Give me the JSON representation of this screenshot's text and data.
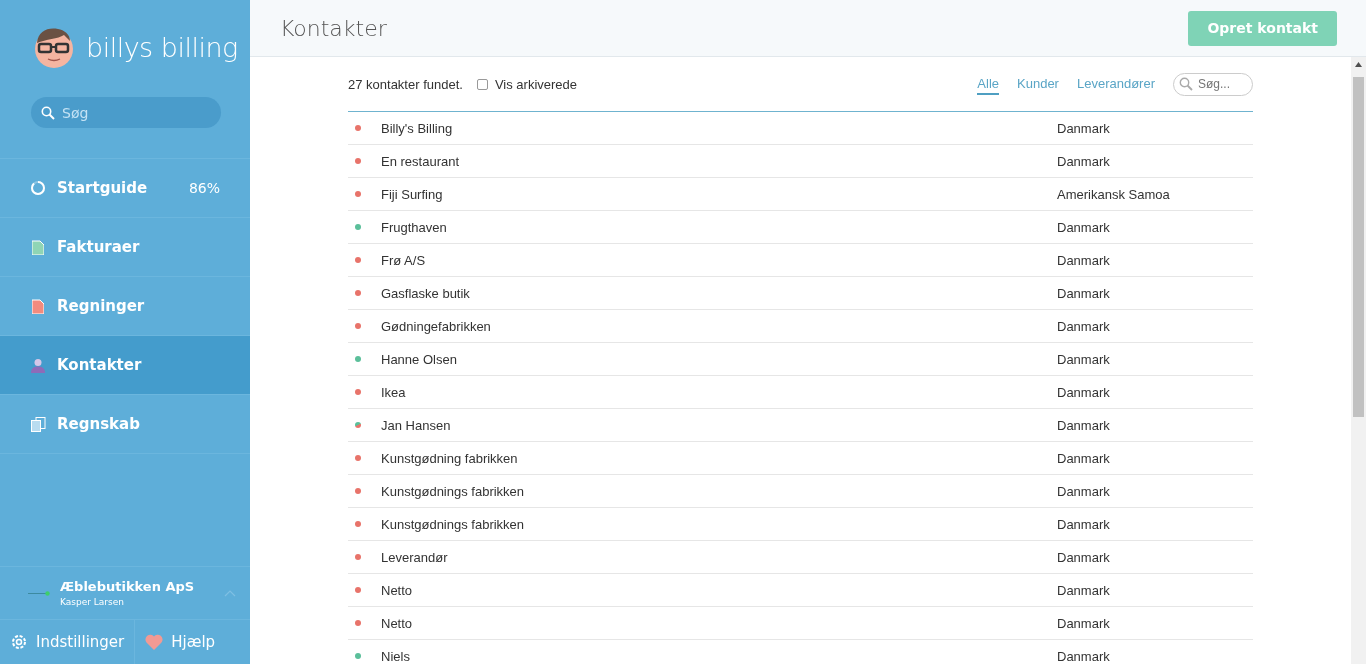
{
  "sidebar": {
    "logo": "billys billing",
    "search": {
      "placeholder": "Søg"
    },
    "items": [
      {
        "label": "Startguide",
        "badge": "86%",
        "selected": false
      },
      {
        "label": "Fakturaer",
        "selected": false
      },
      {
        "label": "Regninger",
        "selected": false
      },
      {
        "label": "Kontakter",
        "selected": true
      },
      {
        "label": "Regnskab",
        "selected": false
      }
    ],
    "company": {
      "name": "Æblebutikken ApS",
      "user": "Kasper Larsen"
    },
    "footer": [
      {
        "label": "Indstillinger"
      },
      {
        "label": "Hjælp"
      }
    ]
  },
  "header": {
    "title": "Kontakter",
    "button": "Opret kontakt"
  },
  "toolbar": {
    "count": "27 kontakter fundet.",
    "archived": {
      "label": "Vis arkiverede",
      "checked": false
    },
    "filters": [
      {
        "label": "Alle",
        "selected": true
      },
      {
        "label": "Kunder",
        "selected": false
      },
      {
        "label": "Leverandører",
        "selected": false
      }
    ],
    "search": {
      "placeholder": "Søg..."
    }
  },
  "contacts": [
    {
      "name": "Billy's Billing",
      "country": "Danmark",
      "kind": "single",
      "color": "#e8736a"
    },
    {
      "name": "En restaurant",
      "country": "Danmark",
      "kind": "single",
      "color": "#e8736a"
    },
    {
      "name": "Fiji Surfing",
      "country": "Amerikansk Samoa",
      "kind": "single",
      "color": "#e8736a"
    },
    {
      "name": "Frugthaven",
      "country": "Danmark",
      "kind": "single",
      "color": "#5bbf9a"
    },
    {
      "name": "Frø A/S",
      "country": "Danmark",
      "kind": "single",
      "color": "#e8736a"
    },
    {
      "name": "Gasflaske butik",
      "country": "Danmark",
      "kind": "single",
      "color": "#e8736a"
    },
    {
      "name": "Gødningefabrikken",
      "country": "Danmark",
      "kind": "single",
      "color": "#e8736a"
    },
    {
      "name": "Hanne Olsen",
      "country": "Danmark",
      "kind": "single",
      "color": "#5bbf9a"
    },
    {
      "name": "Ikea",
      "country": "Danmark",
      "kind": "single",
      "color": "#e8736a"
    },
    {
      "name": "Jan Hansen",
      "country": "Danmark",
      "kind": "split",
      "color": "#e8736a"
    },
    {
      "name": "Kunstgødning fabrikken",
      "country": "Danmark",
      "kind": "single",
      "color": "#e8736a"
    },
    {
      "name": "Kunstgødnings fabrikken",
      "country": "Danmark",
      "kind": "single",
      "color": "#e8736a"
    },
    {
      "name": "Kunstgødnings fabrikken",
      "country": "Danmark",
      "kind": "single",
      "color": "#e8736a"
    },
    {
      "name": "Leverandør",
      "country": "Danmark",
      "kind": "single",
      "color": "#e8736a"
    },
    {
      "name": "Netto",
      "country": "Danmark",
      "kind": "single",
      "color": "#e8736a"
    },
    {
      "name": "Netto",
      "country": "Danmark",
      "kind": "single",
      "color": "#e8736a"
    },
    {
      "name": "Niels",
      "country": "Danmark",
      "kind": "single",
      "color": "#5bbf9a"
    }
  ]
}
